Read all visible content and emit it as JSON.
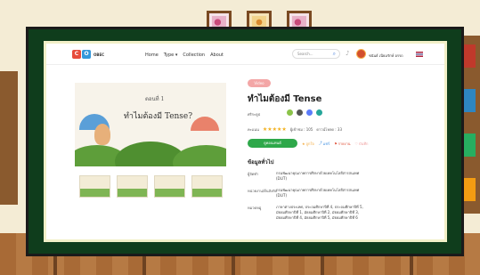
{
  "nav": {
    "logo_text": "OBEC",
    "menu": [
      "Home",
      "Type ▾",
      "Collection",
      "About"
    ],
    "search_placeholder": "Search...",
    "user_name": "ชนันธ์ เนียมรักษ์ อรรถ"
  },
  "preview": {
    "line1": "ตอนที่ 1",
    "line2": "ทำไมต้องมี Tense?"
  },
  "detail": {
    "tag": "Video",
    "title": "ทำไมต้องมี Tense",
    "subject_label": "ศริระดูป",
    "rating_label": "คะแนน",
    "stars": "★★★★★",
    "views_label": "ผู้เข้าชม : 105",
    "downloads_label": "ดาวน์โหลด : 33",
    "action_primary": "ดูคอนเทนต์",
    "action_like": "ถูกใจ",
    "action_share": "แชร์",
    "action_report": "รายงาน",
    "action_save": "บันทึก",
    "section_title": "ข้อมูลทั่วไป",
    "rows": [
      {
        "label": "ผู้จัดทำ",
        "value": "กรมพัฒนาคุณภาพการศึกษาด้วยเทคโนโลยีสารสนเทศ (DLIT)"
      },
      {
        "label": "หน่วยงาน/ต้นสังกัด",
        "value": "กรมพัฒนาคุณภาพการศึกษาด้วยเทคโนโลยีสารสนเทศ (DLIT)"
      },
      {
        "label": "หมวดหมู่",
        "value": "ภาษาต่างประเทศ, ประถมศึกษาปีที่ 4, ประถมศึกษาปีที่ 5, มัธยมศึกษาปีที่ 1, มัธยมศึกษาปีที่ 2, มัธยมศึกษาปีที่ 3, มัธยมศึกษาปีที่ 4, มัธยมศึกษาปีที่ 5, มัธยมศึกษาปีที่ 6"
      }
    ]
  },
  "colors": {
    "board": "#0f3d1c",
    "accent_green": "#2ea84a",
    "tag_pink": "#f3a6a6"
  }
}
